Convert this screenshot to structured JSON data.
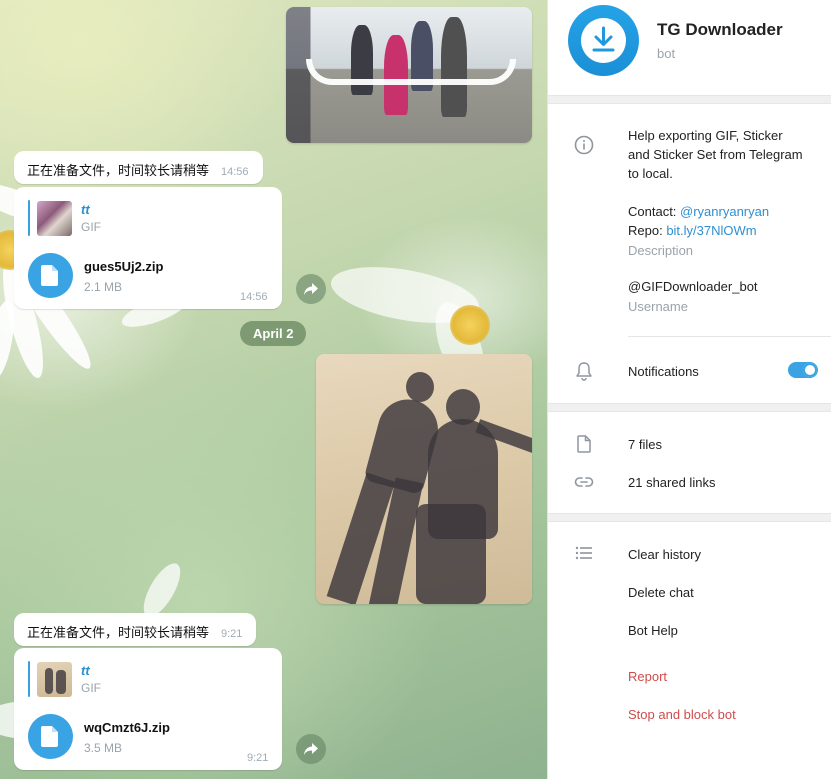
{
  "chat": {
    "date_separator": "April 2",
    "messages": [
      {
        "preparing_text": "正在准备文件，时间较长请稍等",
        "preparing_time": "14:56",
        "reply_name": "tt",
        "reply_type": "GIF",
        "file_name": "gues5Uj2.zip",
        "file_size": "2.1 MB",
        "file_time": "14:56"
      },
      {
        "preparing_text": "正在准备文件，时间较长请稍等",
        "preparing_time": "9:21",
        "reply_name": "tt",
        "reply_type": "GIF",
        "file_name": "wqCmzt6J.zip",
        "file_size": "3.5 MB",
        "file_time": "9:21"
      }
    ]
  },
  "panel": {
    "title": "TG Downloader",
    "subtitle": "bot",
    "description_lines": [
      "Help exporting GIF, Sticker",
      "and Sticker Set from Telegram",
      "to local."
    ],
    "contact_label": "Contact: ",
    "contact_link": "@ryanryanryan",
    "repo_label": "Repo: ",
    "repo_link": "bit.ly/37NlOWm",
    "description_caption": "Description",
    "username": "@GIFDownloader_bot",
    "username_caption": "Username",
    "notifications_label": "Notifications",
    "notifications_on": true,
    "files_label": "7 files",
    "links_label": "21 shared links",
    "actions": {
      "clear_history": "Clear history",
      "delete_chat": "Delete chat",
      "bot_help": "Bot Help",
      "report": "Report",
      "stop_block": "Stop and block bot"
    }
  },
  "colors": {
    "accent": "#3aa3e3",
    "danger": "#cf4c4c",
    "date_pill": "#688760"
  }
}
